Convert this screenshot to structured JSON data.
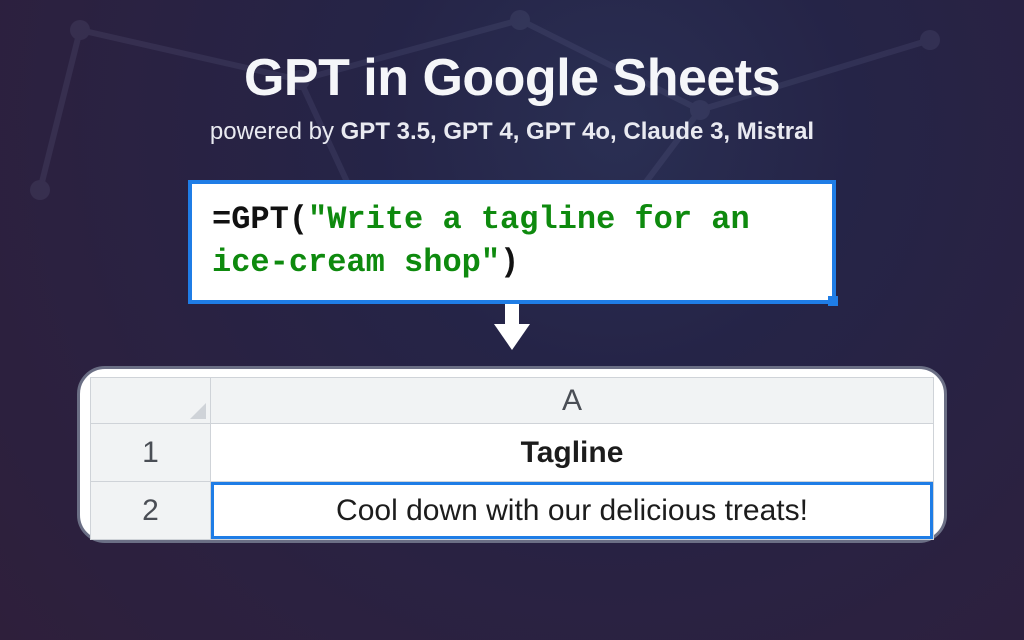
{
  "hero": {
    "title": "GPT in Google Sheets",
    "subtitle_prefix": "powered by ",
    "models": "GPT 3.5, GPT 4, GPT 4o, Claude 3, Mistral"
  },
  "formula": {
    "eq": "=",
    "fn": "GPT",
    "open": "(",
    "str": "\"Write a tagline for an ice-cream shop\"",
    "close": ")"
  },
  "sheet": {
    "col_header": "A",
    "rows": [
      {
        "num": "1",
        "value": "Tagline",
        "bold": true
      },
      {
        "num": "2",
        "value": "Cool down with our delicious treats!",
        "selected": true
      }
    ]
  }
}
